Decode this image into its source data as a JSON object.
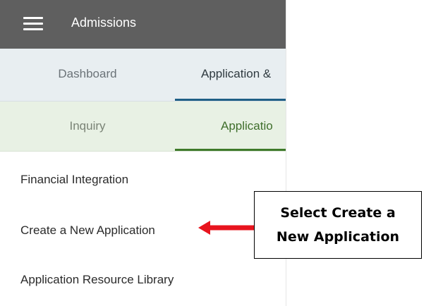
{
  "header": {
    "menu_icon": "hamburger-menu-icon",
    "title": "Admissions",
    "background_color": "#5f5f5f"
  },
  "top_tabs": [
    {
      "label": "Dashboard",
      "active": false
    },
    {
      "label": "Application &",
      "active": true
    }
  ],
  "sub_tabs": [
    {
      "label": "Inquiry",
      "active": false
    },
    {
      "label": "Applicatio",
      "active": true
    }
  ],
  "menu_items": [
    {
      "label": "Financial Integration"
    },
    {
      "label": "Create a New Application"
    },
    {
      "label": "Application Resource Library"
    }
  ],
  "annotation": {
    "callout_text": "Select  Create a\nNew Application",
    "arrow_color": "#e8141e",
    "arrow_icon": "left-arrow-icon"
  },
  "colors": {
    "top_tab_active_underline": "#1f5f86",
    "sub_tab_active_underline": "#3e7a2a",
    "top_nav_background": "#e8eef1",
    "sub_nav_background": "#e8f1e4"
  }
}
